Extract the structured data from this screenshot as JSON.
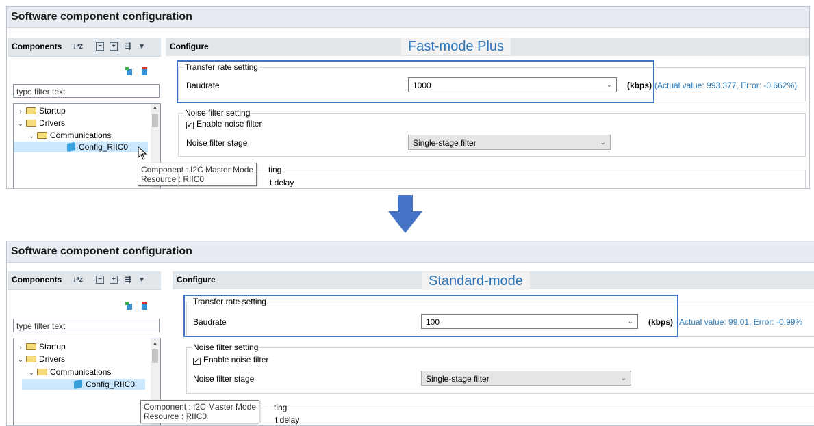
{
  "panels": [
    {
      "title": "Software component configuration",
      "components_header": "Components",
      "configure_header": "Configure",
      "mode_label": "Fast-mode Plus",
      "filter_placeholder": "type filter text",
      "tree": [
        {
          "label": "Startup"
        },
        {
          "label": "Drivers"
        },
        {
          "label": "Communications"
        },
        {
          "label": "Config_RIIC0"
        }
      ],
      "tooltip": {
        "line1": "Component : I2C Master Mode",
        "line2": "Resource : RIIC0"
      },
      "transfer_group": "Transfer rate setting",
      "baudrate_label": "Baudrate",
      "baudrate_value": "1000",
      "unit": "(kbps)",
      "actual": "(Actual value: 993.377, Error: -0.662%)",
      "noise_group": "Noise filter setting",
      "enable_noise": "Enable noise filter",
      "noise_stage_label": "Noise filter stage",
      "noise_stage_value": "Single-stage filter",
      "partial_group": "ting",
      "partial_delay": "t delay"
    },
    {
      "title": "Software component configuration",
      "components_header": "Components",
      "configure_header": "Configure",
      "mode_label": "Standard-mode",
      "filter_placeholder": "type filter text",
      "tree": [
        {
          "label": "Startup"
        },
        {
          "label": "Drivers"
        },
        {
          "label": "Communications"
        },
        {
          "label": "Config_RIIC0"
        }
      ],
      "tooltip": {
        "line1": "Component : I2C Master Mode",
        "line2": "Resource : RIIC0"
      },
      "transfer_group": "Transfer rate setting",
      "baudrate_label": "Baudrate",
      "baudrate_value": "100",
      "unit": "(kbps)",
      "actual": "(Actual value: 99.01, Error: -0.99%",
      "noise_group": "Noise filter setting",
      "enable_noise": "Enable noise filter",
      "noise_stage_label": "Noise filter stage",
      "noise_stage_value": "Single-stage filter",
      "partial_group": "ting",
      "partial_delay": "t delay"
    }
  ],
  "colors": {
    "accent": "#2e75b6",
    "highlight_box": "#4472c4",
    "arrow": "#4472c4",
    "actual_text": "#2a7ab8"
  }
}
